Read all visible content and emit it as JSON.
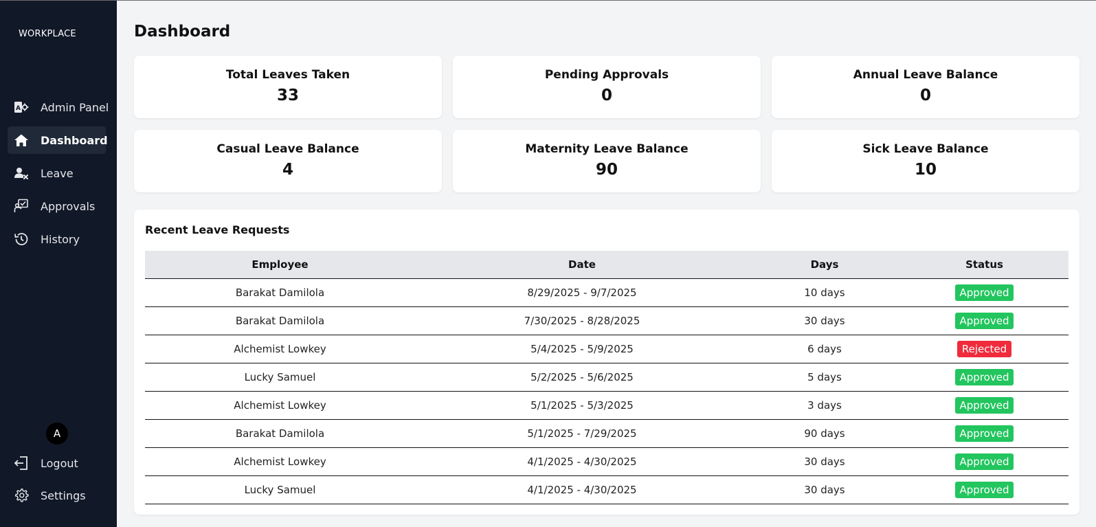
{
  "app": {
    "logo": "WORKPLACE"
  },
  "sidebar": {
    "items": [
      {
        "label": "Admin Panel",
        "icon": "admin-panel-icon"
      },
      {
        "label": "Dashboard",
        "icon": "home-icon",
        "active": true
      },
      {
        "label": "Leave",
        "icon": "user-x-icon"
      },
      {
        "label": "Approvals",
        "icon": "approvals-icon"
      },
      {
        "label": "History",
        "icon": "history-icon"
      }
    ],
    "avatar_initial": "A",
    "bottom": [
      {
        "label": "Logout",
        "icon": "logout-icon"
      },
      {
        "label": "Settings",
        "icon": "gear-icon"
      }
    ]
  },
  "main": {
    "title": "Dashboard",
    "cards": [
      {
        "title": "Total Leaves Taken",
        "value": "33"
      },
      {
        "title": "Pending Approvals",
        "value": "0"
      },
      {
        "title": "Annual Leave Balance",
        "value": "0"
      },
      {
        "title": "Casual Leave Balance",
        "value": "4"
      },
      {
        "title": "Maternity Leave Balance",
        "value": "90"
      },
      {
        "title": "Sick Leave Balance",
        "value": "10"
      }
    ],
    "recent": {
      "title": "Recent Leave Requests",
      "columns": [
        "Employee",
        "Date",
        "Days",
        "Status"
      ],
      "rows": [
        {
          "employee": "Barakat Damilola",
          "date": "8/29/2025 - 9/7/2025",
          "days": "10 days",
          "status": "Approved"
        },
        {
          "employee": "Barakat Damilola",
          "date": "7/30/2025 - 8/28/2025",
          "days": "30 days",
          "status": "Approved"
        },
        {
          "employee": "Alchemist Lowkey",
          "date": "5/4/2025 - 5/9/2025",
          "days": "6 days",
          "status": "Rejected"
        },
        {
          "employee": "Lucky Samuel",
          "date": "5/2/2025 - 5/6/2025",
          "days": "5 days",
          "status": "Approved"
        },
        {
          "employee": "Alchemist Lowkey",
          "date": "5/1/2025 - 5/3/2025",
          "days": "3 days",
          "status": "Approved"
        },
        {
          "employee": "Barakat Damilola",
          "date": "5/1/2025 - 7/29/2025",
          "days": "90 days",
          "status": "Approved"
        },
        {
          "employee": "Alchemist Lowkey",
          "date": "4/1/2025 - 4/30/2025",
          "days": "30 days",
          "status": "Approved"
        },
        {
          "employee": "Lucky Samuel",
          "date": "4/1/2025 - 4/30/2025",
          "days": "30 days",
          "status": "Approved"
        }
      ]
    }
  },
  "colors": {
    "sidebar_bg": "#111827",
    "sidebar_active": "#1f2937",
    "page_bg": "#f3f4f6",
    "approved": "#22c55e",
    "rejected": "#ef2b3c"
  }
}
